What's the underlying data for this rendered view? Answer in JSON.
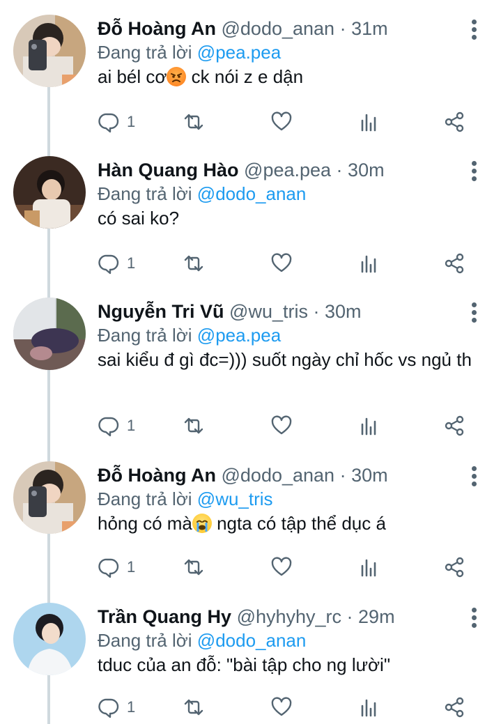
{
  "tweets": [
    {
      "name": "Đỗ Hoàng An",
      "handle": "@dodo_anan",
      "time": "31m",
      "reply_prefix": "Đang trả lời",
      "reply_to": "@pea.pea",
      "text_before": "ai bél cơ",
      "emoji": "angry-face",
      "text_after": " ck nói z e dận",
      "replies": "1"
    },
    {
      "name": "Hàn Quang Hào",
      "handle": "@pea.pea",
      "time": "30m",
      "reply_prefix": "Đang trả lời",
      "reply_to": "@dodo_anan",
      "text": "có sai ko?",
      "replies": "1"
    },
    {
      "name": "Nguyễn Tri Vũ",
      "handle": "@wu_tris",
      "time": "30m",
      "reply_prefix": "Đang trả lời",
      "reply_to": "@pea.pea",
      "text": "sai kiểu đ gì đc=))) suốt ngày chỉ hốc vs ngủ th",
      "replies": "1"
    },
    {
      "name": "Đỗ Hoàng An",
      "handle": "@dodo_anan",
      "time": "30m",
      "reply_prefix": "Đang trả lời",
      "reply_to": "@wu_tris",
      "text_before": "hỏng có mà",
      "emoji": "crying-face",
      "text_after": " ngta có tập thể dục á",
      "replies": "1"
    },
    {
      "name": "Trần Quang Hy",
      "handle": "@hyhyhy_rc",
      "time": "29m",
      "reply_prefix": "Đang trả lời",
      "reply_to": "@dodo_anan",
      "text": "tduc của an đỗ: \"bài tập cho ng lười\"",
      "replies": "1"
    }
  ],
  "separator": " · ",
  "colors": {
    "accent": "#1d9bf0",
    "muted": "#536471",
    "text": "#0f1419",
    "thread_line": "#cfd9de"
  }
}
